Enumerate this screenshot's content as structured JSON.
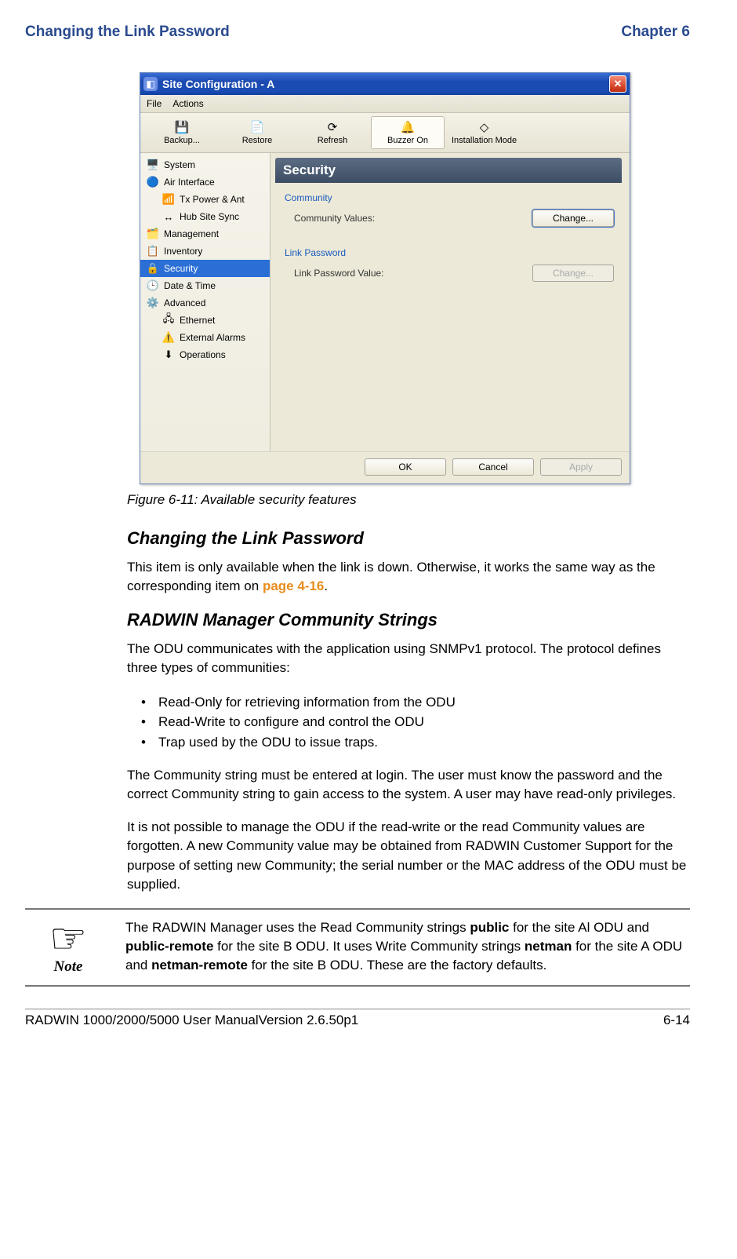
{
  "header": {
    "left": "Changing the Link Password",
    "right": "Chapter 6"
  },
  "window": {
    "title": "Site Configuration - A",
    "menubar": [
      "File",
      "Actions"
    ],
    "toolbar": [
      {
        "label": "Backup...",
        "icon": "💾"
      },
      {
        "label": "Restore",
        "icon": "📄"
      },
      {
        "label": "Refresh",
        "icon": "⟳"
      },
      {
        "label": "Buzzer On",
        "icon": "🔔",
        "selected": true
      },
      {
        "label": "Installation Mode",
        "icon": "◇"
      }
    ],
    "sidebar": [
      {
        "label": "System",
        "icon": "🖥️"
      },
      {
        "label": "Air Interface",
        "icon": "🔵"
      },
      {
        "label": "Tx Power & Ant",
        "icon": "📶",
        "sub": true
      },
      {
        "label": "Hub Site Sync",
        "icon": "↔",
        "sub": true
      },
      {
        "label": "Management",
        "icon": "🗂️"
      },
      {
        "label": "Inventory",
        "icon": "📋"
      },
      {
        "label": "Security",
        "icon": "🔒",
        "selected": true
      },
      {
        "label": "Date & Time",
        "icon": "🕒"
      },
      {
        "label": "Advanced",
        "icon": "⚙️"
      },
      {
        "label": "Ethernet",
        "icon": "🖧",
        "sub": true
      },
      {
        "label": "External Alarms",
        "icon": "⚠️",
        "sub": true
      },
      {
        "label": "Operations",
        "icon": "⬇",
        "sub": true
      }
    ],
    "panel": {
      "heading": "Security",
      "community": {
        "legend": "Community",
        "label": "Community Values:",
        "button": "Change..."
      },
      "linkpw": {
        "legend": "Link Password",
        "label": "Link Password Value:",
        "button": "Change..."
      }
    },
    "dialog_buttons": {
      "ok": "OK",
      "cancel": "Cancel",
      "apply": "Apply"
    }
  },
  "figure_caption": "Figure 6-11: Available security features",
  "section1": {
    "heading": "Changing the Link Password",
    "p1a": "This item is only available when the link is down. Otherwise, it works the same way as the corresponding item on ",
    "p1_link": "page 4-16",
    "p1b": "."
  },
  "section2": {
    "heading": "RADWIN Manager Community Strings",
    "p1": "The ODU communicates with the application using SNMPv1 protocol. The protocol defines three types of communities:",
    "bullets": [
      "Read-Only for retrieving information from the ODU",
      "Read-Write to configure and control the ODU",
      "Trap used by the ODU to issue traps."
    ],
    "p2": "The Community string must be entered at login. The user must know the password and the correct Community string to gain access to the system. A user may have read-only privileges.",
    "p3": "It is not possible to manage the ODU if the read-write or the read Community values are forgotten. A new Community value may be obtained from RADWIN Customer Support for the purpose of setting new Community; the serial number or the MAC address of the ODU must be supplied."
  },
  "note": {
    "label": "Note",
    "t1": "The RADWIN Manager uses the Read Community strings ",
    "b1": "public",
    "t2": " for the site Al ODU and ",
    "b2": "public-remote",
    "t3": " for the site B ODU. It uses Write Community strings ",
    "b3": "netman",
    "t4": " for the site A ODU and ",
    "b4": "netman-remote",
    "t5": " for the site B ODU. These are the factory defaults."
  },
  "footer": {
    "left": "RADWIN 1000/2000/5000 User ManualVersion  2.6.50p1",
    "right": "6-14"
  }
}
